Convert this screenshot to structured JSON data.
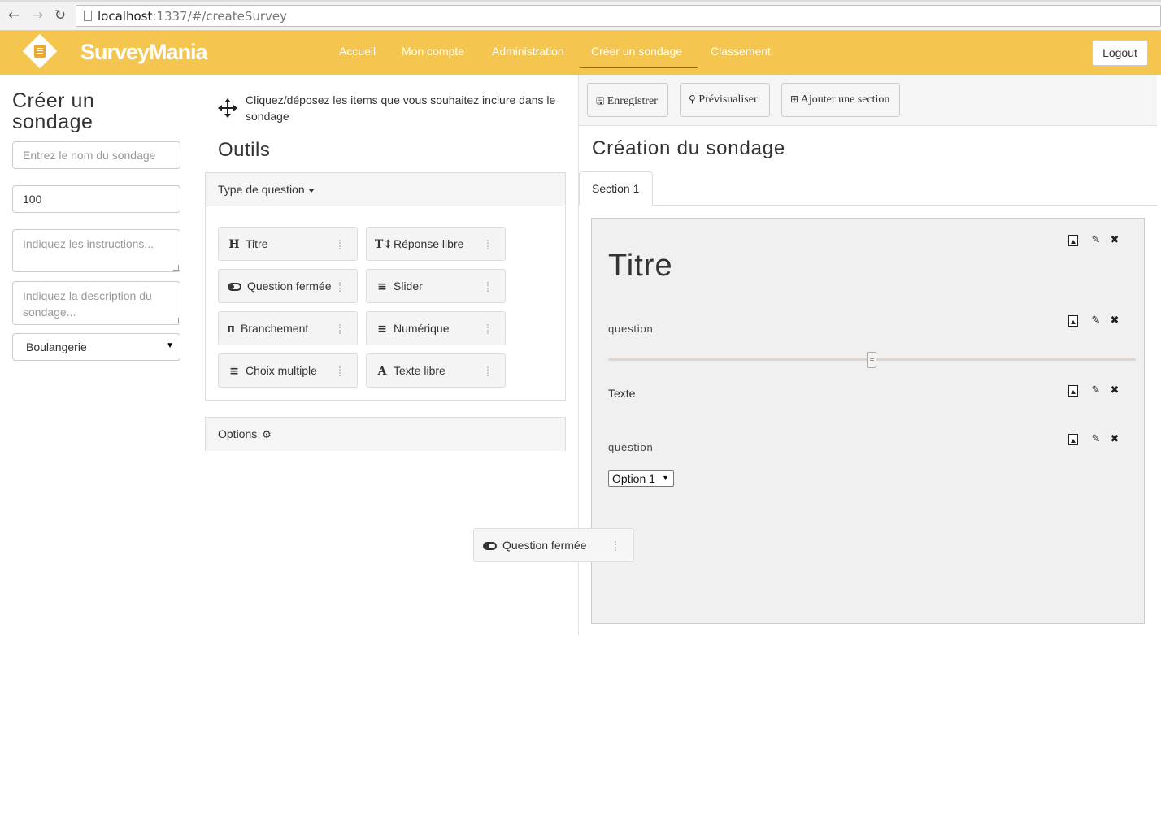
{
  "browser": {
    "url_host": "localhost",
    "url_rest": ":1337/#/createSurvey"
  },
  "navbar": {
    "brand": "SurveyMania",
    "links": [
      "Accueil",
      "Mon compte",
      "Administration",
      "Créer un sondage",
      "Classement"
    ],
    "active": "Créer un sondage",
    "logout_label": "Logout",
    "color": "#f5c64f"
  },
  "left": {
    "title": "Créer un sondage",
    "name_placeholder": "Entrez le nom du sondage",
    "points_value": "100",
    "instructions_placeholder": "Indiquez les instructions...",
    "description_placeholder": "Indiquez la description du sondage...",
    "category_selected": "Boulangerie"
  },
  "middle": {
    "hint": "Cliquez/déposez les items que vous souhaitez inclure dans le sondage",
    "tools_title": "Outils",
    "question_type_heading": "Type de question",
    "tools": [
      {
        "label": "Titre",
        "icon": "heading-icon"
      },
      {
        "label": "Réponse libre",
        "icon": "text-height-icon"
      },
      {
        "label": "Question fermée",
        "icon": "toggle-icon"
      },
      {
        "label": "Slider",
        "icon": "sliders-icon"
      },
      {
        "label": "Branchement",
        "icon": "branch-icon"
      },
      {
        "label": "Numérique",
        "icon": "ordered-list-icon"
      },
      {
        "label": "Choix multiple",
        "icon": "list-icon"
      },
      {
        "label": "Texte libre",
        "icon": "font-icon"
      }
    ],
    "options_heading": "Options"
  },
  "right": {
    "toolbar": {
      "save_label": "Enregistrer",
      "preview_label": "Prévisualiser",
      "add_section_label": "Ajouter une section"
    },
    "title": "Création du sondage",
    "tab_label": "Section 1",
    "section": {
      "title_text": "Titre",
      "slider_question": "question",
      "slider_level": 0.5,
      "text_item": "Texte",
      "dropdown_question": "question",
      "dropdown_selected": "Option 1"
    }
  },
  "drag_ghost": {
    "label": "Question fermée"
  }
}
